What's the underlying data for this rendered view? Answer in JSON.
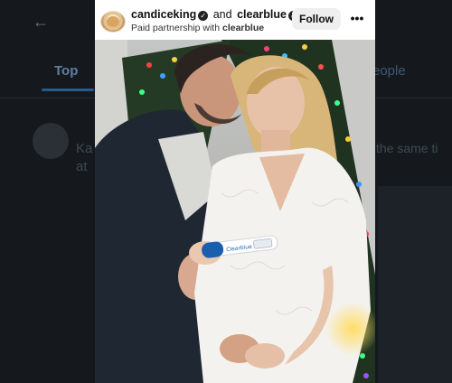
{
  "background": {
    "back_icon": "arrow-left-icon",
    "tab_top_label": "Top",
    "tab_right_fragment": "eople",
    "snippet_left": "Ka",
    "snippet_left_2": "at",
    "snippet_right": "the same ti"
  },
  "post": {
    "account_name": "candiceking",
    "connector": "and",
    "partner_name": "clearblue",
    "paid_prefix": "Paid partnership with",
    "paid_partner": "clearblue",
    "follow_label": "Follow",
    "more_icon": "more-horizontal-icon",
    "verified_icon": "verified-badge-icon",
    "test_brand_text": "Clearblue"
  },
  "colors": {
    "background": "#15191d",
    "accent_blue": "#2b5a8a",
    "card": "#ffffff",
    "follow_bg": "#efefef"
  }
}
